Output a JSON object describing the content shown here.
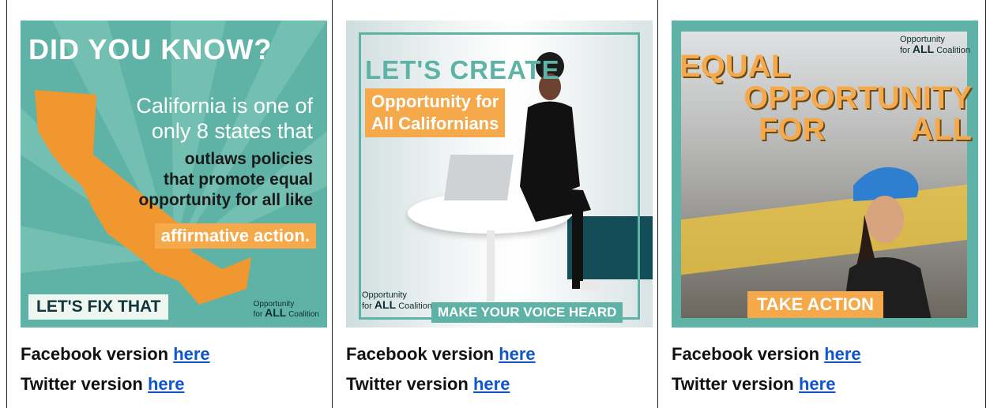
{
  "cards": [
    {
      "banner": {
        "title": "DID YOU KNOW?",
        "lines_white": [
          "California is one of",
          "only 8 states that"
        ],
        "lines_dark": [
          "outlaws policies",
          "that promote equal",
          "opportunity for all like"
        ],
        "highlight": "affirmative action.",
        "cta": "LET'S FIX THAT",
        "logo": [
          "Opportunity",
          "for",
          "ALL",
          "Coalition"
        ]
      },
      "facebook_label": "Facebook version ",
      "twitter_label": "Twitter version ",
      "link_text": "here"
    },
    {
      "banner": {
        "title": "LET'S CREATE",
        "subtitle": [
          "Opportunity for",
          "All Californians"
        ],
        "cta": "MAKE YOUR VOICE HEARD",
        "logo": [
          "Opportunity",
          "for",
          "ALL",
          "Coalition"
        ]
      },
      "facebook_label": "Facebook version ",
      "twitter_label": "Twitter version ",
      "link_text": "here"
    },
    {
      "banner": {
        "title_lines": [
          "EQUAL",
          "OPPORTUNITY",
          "FOR",
          "ALL"
        ],
        "cta": "TAKE ACTION",
        "logo": [
          "Opportunity",
          "for",
          "ALL",
          "Coalition"
        ]
      },
      "facebook_label": "Facebook version ",
      "twitter_label": "Twitter version ",
      "link_text": "here"
    }
  ],
  "colors": {
    "teal": "#5fb3a6",
    "orange": "#f6a94a",
    "link": "#1155cc"
  }
}
